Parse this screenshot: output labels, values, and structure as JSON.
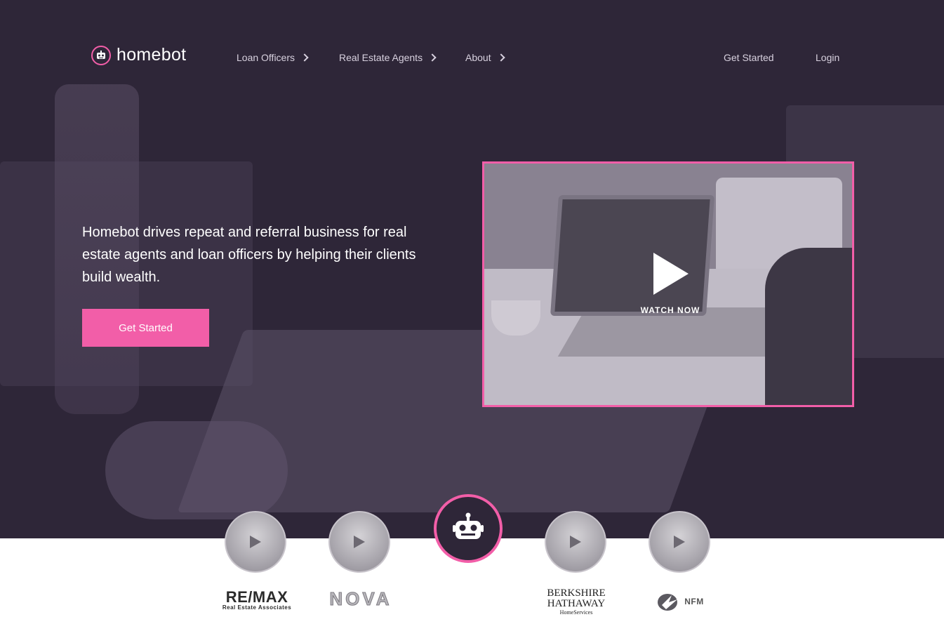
{
  "brand": {
    "name": "homebot",
    "accent": "#f25ea8",
    "hero_bg": "#2e2638"
  },
  "nav": {
    "items": [
      {
        "label": "Loan Officers"
      },
      {
        "label": "Real Estate Agents"
      },
      {
        "label": "About"
      }
    ],
    "get_started": "Get Started",
    "login": "Login"
  },
  "hero": {
    "headline": "Homebot drives repeat and referral business for real estate agents and loan officers by helping their clients build wealth.",
    "cta_label": "Get Started"
  },
  "video": {
    "watch_label": "WATCH NOW",
    "icon": "play-icon"
  },
  "testimonials": {
    "avatars": [
      {
        "icon": "play-icon"
      },
      {
        "icon": "play-icon"
      },
      {
        "icon": "robot-icon"
      },
      {
        "icon": "play-icon"
      },
      {
        "icon": "play-icon"
      }
    ]
  },
  "logos": {
    "remax": {
      "name": "RE/MAX",
      "sub": "Real Estate Associates"
    },
    "nova": {
      "name": "NOVA"
    },
    "bhhs": {
      "line1": "BERKSHIRE",
      "line2": "HATHAWAY",
      "sub": "HomeServices"
    },
    "nfm": {
      "name": "NFM"
    }
  }
}
